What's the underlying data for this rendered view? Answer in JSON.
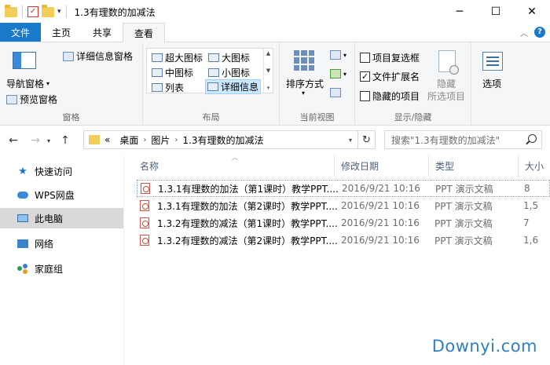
{
  "window": {
    "title": "1.3有理数的加减法"
  },
  "tabs": [
    {
      "label": "文件"
    },
    {
      "label": "主页"
    },
    {
      "label": "共享"
    },
    {
      "label": "查看"
    }
  ],
  "ribbon": {
    "panes": {
      "nav_pane": "导航窗格",
      "preview_pane": "预览窗格",
      "details_pane": "详细信息窗格",
      "label": "窗格"
    },
    "layout": {
      "items": [
        "超大图标",
        "大图标",
        "中图标",
        "小图标",
        "列表",
        "详细信息"
      ],
      "selected": "详细信息",
      "label": "布局"
    },
    "current_view": {
      "sort": "排序方式",
      "label": "当前视图"
    },
    "show_hide": {
      "item_checkboxes": "项目复选框",
      "file_extensions": "文件扩展名",
      "hidden_items": "隐藏的项目",
      "file_extensions_checked": true,
      "hide_selected_line1": "隐藏",
      "hide_selected_line2": "所选项目",
      "label": "显示/隐藏"
    },
    "options": "选项"
  },
  "address": {
    "overflow": "«",
    "crumbs": [
      "桌面",
      "图片",
      "1.3有理数的加减法"
    ]
  },
  "search": {
    "placeholder": "搜索\"1.3有理数的加减法\""
  },
  "leftnav": {
    "items": [
      {
        "label": "快速访问"
      },
      {
        "label": "WPS网盘"
      },
      {
        "label": "此电脑"
      },
      {
        "label": "网络"
      },
      {
        "label": "家庭组"
      }
    ],
    "selected": "此电脑"
  },
  "columns": {
    "name": "名称",
    "date": "修改日期",
    "type": "类型",
    "size": "大小"
  },
  "files": [
    {
      "name": "1.3.1有理数的加法（第1课时）教学PPT....",
      "date": "2016/9/21 10:16",
      "type": "PPT 演示文稿",
      "size": "8"
    },
    {
      "name": "1.3.1有理数的加法（第2课时）教学PPT....",
      "date": "2016/9/21 10:16",
      "type": "PPT 演示文稿",
      "size": "1,5"
    },
    {
      "name": "1.3.2有理数的减法（第1课时）教学PPT....",
      "date": "2016/9/21 10:16",
      "type": "PPT 演示文稿",
      "size": "7"
    },
    {
      "name": "1.3.2有理数的减法（第2课时）教学PPT....",
      "date": "2016/9/21 10:16",
      "type": "PPT 演示文稿",
      "size": "1,6"
    }
  ],
  "watermark": "Downyi.com",
  "colors": {
    "accent": "#1979ca",
    "selection": "#cce8ff",
    "watermark": "#2f7fc1"
  }
}
